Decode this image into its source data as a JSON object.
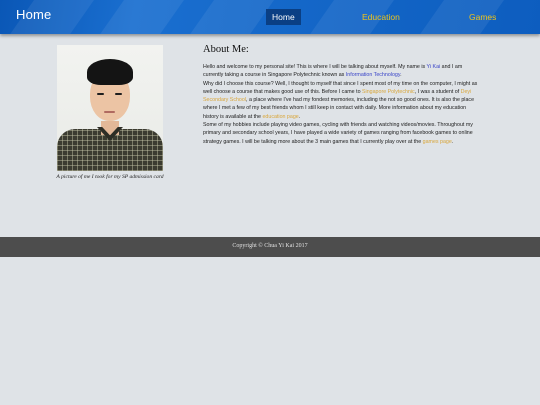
{
  "header": {
    "brand": "Home",
    "nav": [
      {
        "label": "Home",
        "active": true
      },
      {
        "label": "Education",
        "active": false
      },
      {
        "label": "Games",
        "active": false
      }
    ],
    "colors": {
      "bar": "#1467c8",
      "nav_text": "#f0c419",
      "active_bg": "#0a3f84"
    }
  },
  "photo": {
    "caption": "A picture of me I took for my SP admission card"
  },
  "about": {
    "title": "About Me:",
    "p1_text1": "Hello and welcome to my personal site! This is where I will be talking about myself. My name is ",
    "p1_link1": "Yi Kai",
    "p1_text2": " and I am currently taking a course in Singapore Polytechnic known as ",
    "p1_link2": "Information Technology",
    "p1_text3": ".",
    "p2_text1": "Why did I choose this course? Well, I thought to myself that since I spent most of my time on the computer, I might as well choose a course that makes good use of this. Before I came to ",
    "p2_link1": "Singapore Polytechnic",
    "p2_text2": ", I was a student of ",
    "p2_link2": "Deyi Secondary School",
    "p2_text3": ", a place where I've had my fondest memories, including the not so good ones. It is also the place where I met a few of my best friends whom I still keep in contact with daily. More information about my education history is available at the ",
    "p2_link3": "education page",
    "p2_text4": ".",
    "p3_text1": "Some of my hobbies include playing video games, cycling with friends and watching videos/movies. Throughout my primary and secondary school years, I have played a wide variety of games ranging from facebook games to online strategy games. I will be talking more about the 3 main games that I currently play over at the ",
    "p3_link1": "games page",
    "p3_text2": "."
  },
  "footer": {
    "text": "Copyright © Chua Yi Kai 2017"
  }
}
